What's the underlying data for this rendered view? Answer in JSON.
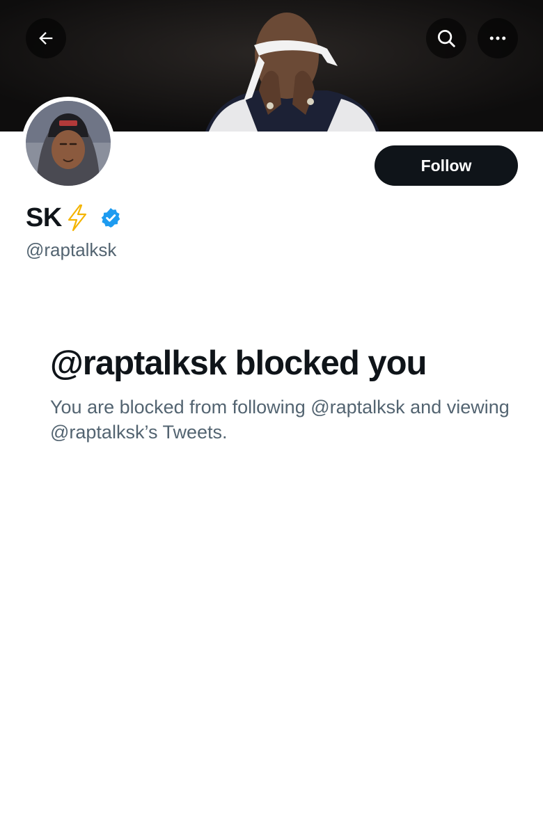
{
  "header": {
    "back_icon": "arrow-left-icon",
    "search_icon": "search-icon",
    "more_icon": "more-horizontal-icon"
  },
  "profile": {
    "display_name": "SK",
    "bolt_icon": "lightning-bolt-emoji",
    "verified_icon": "verified-badge-icon",
    "verified_color": "#1d9bf0",
    "handle": "@raptalksk",
    "follow_label": "Follow"
  },
  "blocked": {
    "title": "@raptalksk blocked you",
    "description": "You are blocked from following @raptalksk and viewing @raptalksk’s Tweets."
  }
}
